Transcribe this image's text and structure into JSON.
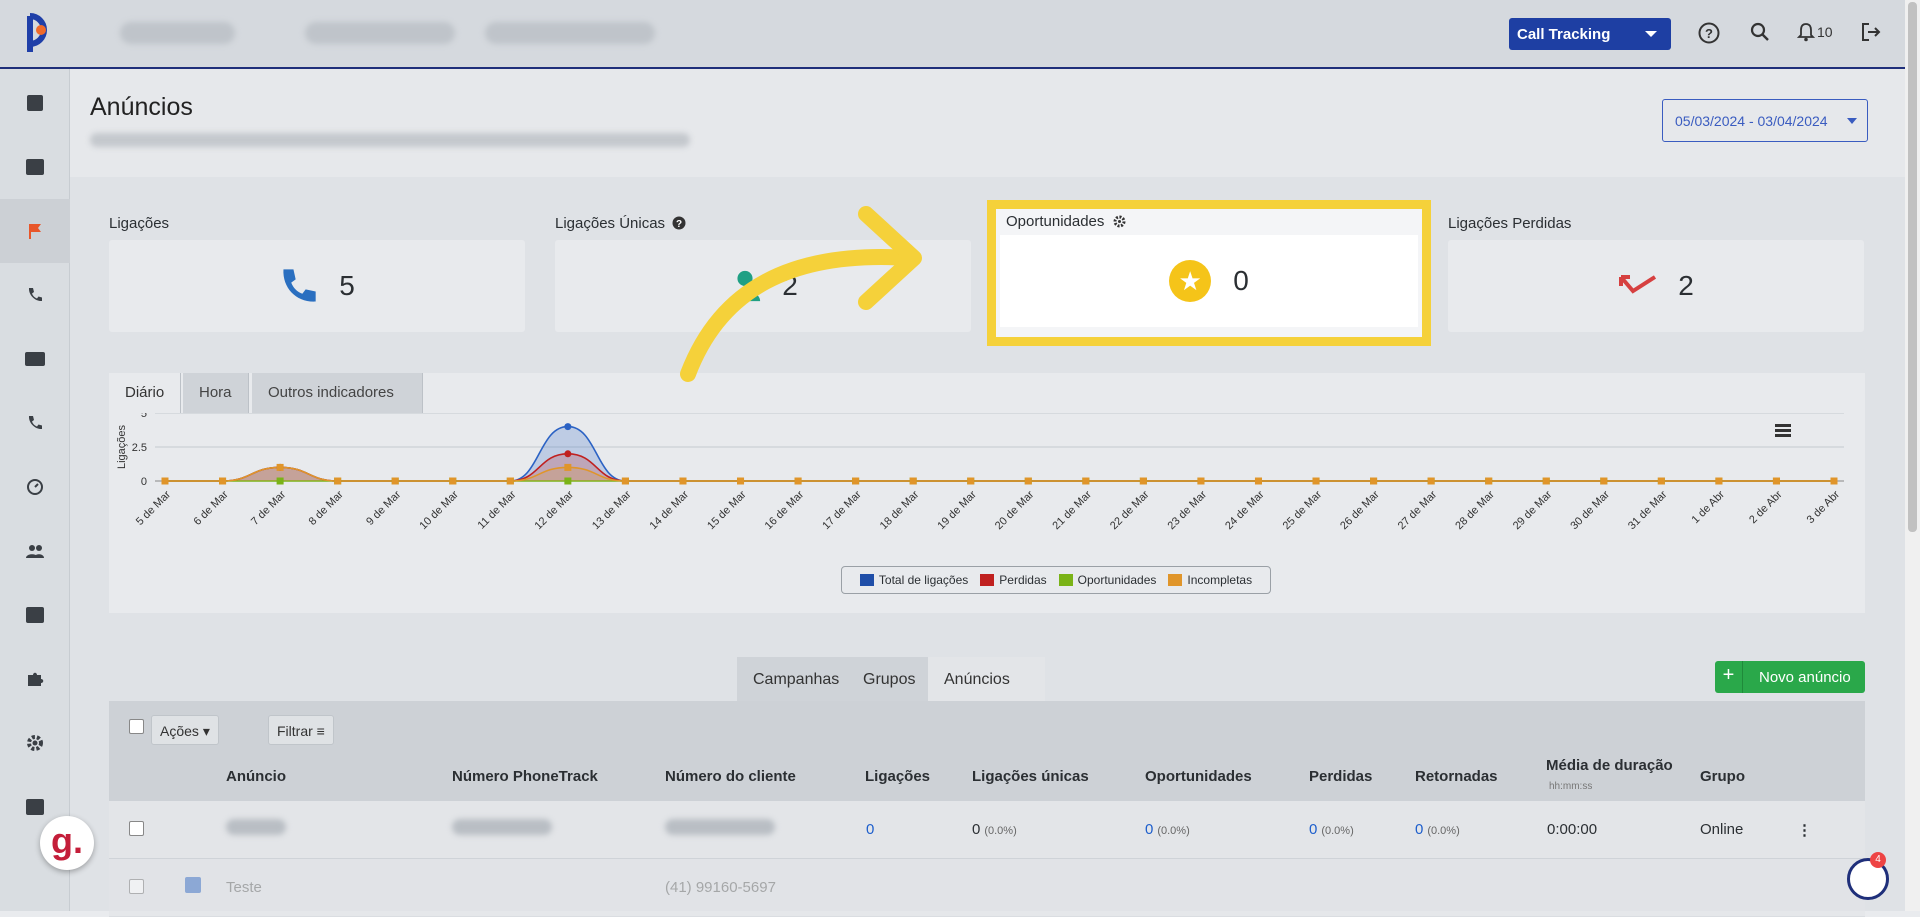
{
  "header": {
    "call_tracking_label": "Call Tracking",
    "notifications_count": "10"
  },
  "page": {
    "title": "Anúncios",
    "date_range": "05/03/2024 - 03/04/2024"
  },
  "kpis": {
    "ligacoes": {
      "label": "Ligações",
      "value": "5"
    },
    "unicas": {
      "label": "Ligações Únicas",
      "value": "2"
    },
    "oportunidades": {
      "label": "Oportunidades",
      "value": "0"
    },
    "perdidas": {
      "label": "Ligações Perdidas",
      "value": "2"
    }
  },
  "chart_tabs": [
    "Diário",
    "Hora",
    "Outros indicadores"
  ],
  "chart_data": {
    "type": "area",
    "ylabel": "Ligações",
    "ylim": [
      0,
      5
    ],
    "yticks": [
      "5",
      "2.5",
      "0"
    ],
    "categories": [
      "5 de Mar",
      "6 de Mar",
      "7 de Mar",
      "8 de Mar",
      "9 de Mar",
      "10 de Mar",
      "11 de Mar",
      "12 de Mar",
      "13 de Mar",
      "14 de Mar",
      "15 de Mar",
      "16 de Mar",
      "17 de Mar",
      "18 de Mar",
      "19 de Mar",
      "20 de Mar",
      "21 de Mar",
      "22 de Mar",
      "23 de Mar",
      "24 de Mar",
      "25 de Mar",
      "26 de Mar",
      "27 de Mar",
      "28 de Mar",
      "29 de Mar",
      "30 de Mar",
      "31 de Mar",
      "1 de Abr",
      "2 de Abr",
      "3 de Abr"
    ],
    "series": [
      {
        "name": "Total de ligações",
        "color": "#2b62c4",
        "values": [
          0,
          0,
          1,
          0,
          0,
          0,
          0,
          4,
          0,
          0,
          0,
          0,
          0,
          0,
          0,
          0,
          0,
          0,
          0,
          0,
          0,
          0,
          0,
          0,
          0,
          0,
          0,
          0,
          0,
          0
        ]
      },
      {
        "name": "Perdidas",
        "color": "#c0201f",
        "values": [
          0,
          0,
          1,
          0,
          0,
          0,
          0,
          2,
          0,
          0,
          0,
          0,
          0,
          0,
          0,
          0,
          0,
          0,
          0,
          0,
          0,
          0,
          0,
          0,
          0,
          0,
          0,
          0,
          0,
          0
        ]
      },
      {
        "name": "Oportunidades",
        "color": "#7ab317",
        "values": [
          0,
          0,
          0,
          0,
          0,
          0,
          0,
          0,
          0,
          0,
          0,
          0,
          0,
          0,
          0,
          0,
          0,
          0,
          0,
          0,
          0,
          0,
          0,
          0,
          0,
          0,
          0,
          0,
          0,
          0
        ]
      },
      {
        "name": "Incompletas",
        "color": "#e0952a",
        "values": [
          0,
          0,
          1,
          0,
          0,
          0,
          0,
          1,
          0,
          0,
          0,
          0,
          0,
          0,
          0,
          0,
          0,
          0,
          0,
          0,
          0,
          0,
          0,
          0,
          0,
          0,
          0,
          0,
          0,
          0
        ]
      }
    ]
  },
  "bottom_tabs": [
    "Campanhas",
    "Grupos",
    "Anúncios"
  ],
  "new_button": "Novo anúncio",
  "table": {
    "actions_label": "Ações",
    "filter_label": "Filtrar",
    "columns": [
      "Anúncio",
      "Número PhoneTrack",
      "Número do cliente",
      "Ligações",
      "Ligações únicas",
      "Oportunidades",
      "Perdidas",
      "Retornadas",
      "Média de duração",
      "Grupo"
    ],
    "duration_sub": "hh:mm:ss",
    "rows": [
      {
        "ligacoes": "0",
        "unicas": "0",
        "unicas_pct": "(0.0%)",
        "oport": "0",
        "oport_pct": "(0.0%)",
        "perdidas": "0",
        "perdidas_pct": "(0.0%)",
        "retornadas": "0",
        "retornadas_pct": "(0.0%)",
        "duracao": "0:00:00",
        "grupo": "Online"
      },
      {
        "anuncio": "Teste",
        "cliente": "(41) 99160-5697"
      }
    ]
  },
  "floating": {
    "g_label": "g.",
    "pt_count": "4"
  }
}
